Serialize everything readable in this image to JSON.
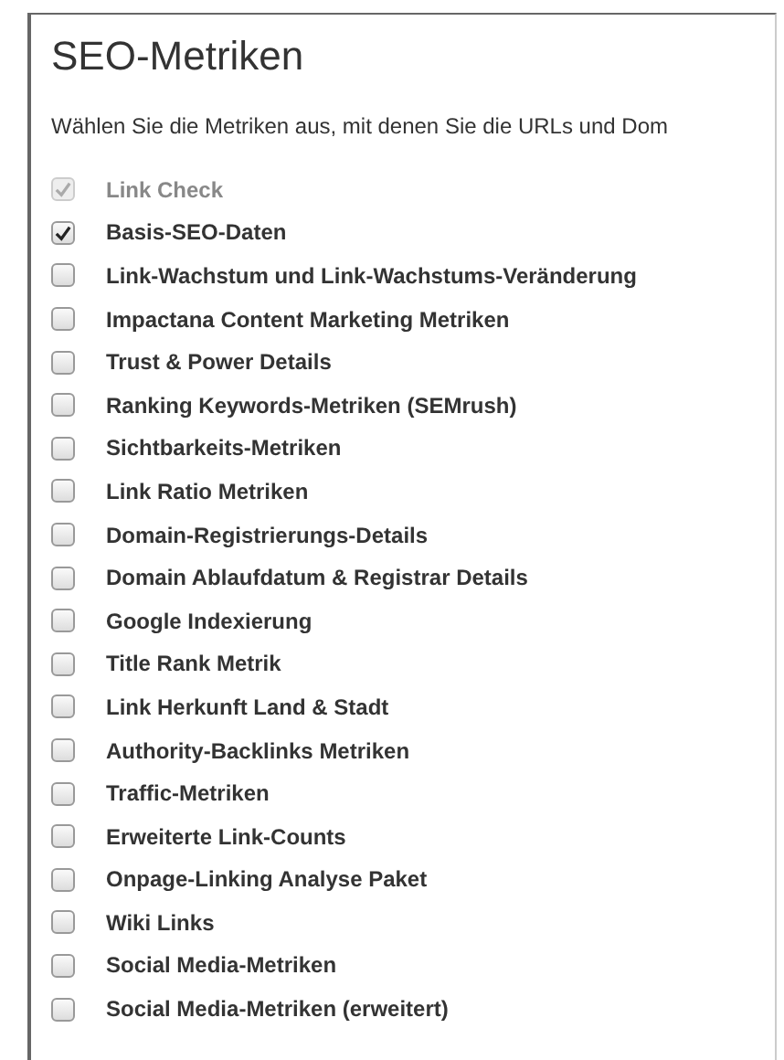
{
  "title": "SEO-Metriken",
  "description": "Wählen Sie die Metriken aus, mit denen Sie die URLs und Dom",
  "options": [
    {
      "label": "Link Check",
      "checked": true,
      "disabled": true
    },
    {
      "label": "Basis-SEO-Daten",
      "checked": true,
      "disabled": false
    },
    {
      "label": "Link-Wachstum und Link-Wachstums-Veränderung",
      "checked": false,
      "disabled": false
    },
    {
      "label": "Impactana Content Marketing Metriken",
      "checked": false,
      "disabled": false
    },
    {
      "label": "Trust & Power Details",
      "checked": false,
      "disabled": false
    },
    {
      "label": "Ranking Keywords-Metriken (SEMrush)",
      "checked": false,
      "disabled": false
    },
    {
      "label": "Sichtbarkeits-Metriken",
      "checked": false,
      "disabled": false
    },
    {
      "label": "Link Ratio Metriken",
      "checked": false,
      "disabled": false
    },
    {
      "label": "Domain-Registrierungs-Details",
      "checked": false,
      "disabled": false
    },
    {
      "label": "Domain Ablaufdatum & Registrar Details",
      "checked": false,
      "disabled": false
    },
    {
      "label": "Google Indexierung",
      "checked": false,
      "disabled": false
    },
    {
      "label": "Title Rank Metrik",
      "checked": false,
      "disabled": false
    },
    {
      "label": "Link Herkunft Land & Stadt",
      "checked": false,
      "disabled": false
    },
    {
      "label": "Authority-Backlinks Metriken",
      "checked": false,
      "disabled": false
    },
    {
      "label": "Traffic-Metriken",
      "checked": false,
      "disabled": false
    },
    {
      "label": "Erweiterte Link-Counts",
      "checked": false,
      "disabled": false
    },
    {
      "label": "Onpage-Linking Analyse Paket",
      "checked": false,
      "disabled": false
    },
    {
      "label": "Wiki Links",
      "checked": false,
      "disabled": false
    },
    {
      "label": "Social Media-Metriken",
      "checked": false,
      "disabled": false
    },
    {
      "label": "Social Media-Metriken (erweitert)",
      "checked": false,
      "disabled": false
    }
  ]
}
